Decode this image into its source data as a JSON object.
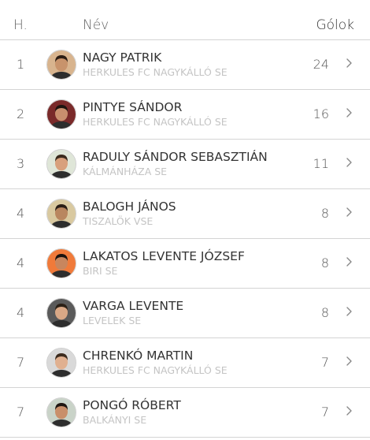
{
  "header": {
    "rank_label": "H.",
    "name_label": "Név",
    "goals_label": "Gólok"
  },
  "rows": [
    {
      "rank": "1",
      "name": "NAGY PATRIK",
      "club": "HERKULES FC NAGYKÁLLÓ SE",
      "goals": "24",
      "avatar_bg": "#d8b48e",
      "skin": "#c8936b",
      "hair": "#2b1d14"
    },
    {
      "rank": "2",
      "name": "PINTYE SÁNDOR",
      "club": "HERKULES FC NAGYKÁLLÓ SE",
      "goals": "16",
      "avatar_bg": "#7a2a2a",
      "skin": "#c98f6e",
      "hair": "#1e1410"
    },
    {
      "rank": "3",
      "name": "RADULY SÁNDOR SEBASZTIÁN",
      "club": "KÁLMÁNHÁZA SE",
      "goals": "11",
      "avatar_bg": "#dfe6d8",
      "skin": "#d8a07c",
      "hair": "#3a2a1c"
    },
    {
      "rank": "4",
      "name": "BALOGH JÁNOS",
      "club": "TISZALÖK VSE",
      "goals": "8",
      "avatar_bg": "#d9c9a0",
      "skin": "#b9865f",
      "hair": "#2a1e16"
    },
    {
      "rank": "4",
      "name": "LAKATOS LEVENTE JÓZSEF",
      "club": "BIRI SE",
      "goals": "8",
      "avatar_bg": "#f07a3a",
      "skin": "#c8865e",
      "hair": "#1a120e"
    },
    {
      "rank": "4",
      "name": "VARGA LEVENTE",
      "club": "LEVELEK SE",
      "goals": "8",
      "avatar_bg": "#5a5a5a",
      "skin": "#d9a886",
      "hair": "#2b2016"
    },
    {
      "rank": "7",
      "name": "CHRENKÓ MARTIN",
      "club": "HERKULES FC NAGYKÁLLÓ SE",
      "goals": "7",
      "avatar_bg": "#d9d9d9",
      "skin": "#e0b090",
      "hair": "#3b2a1d"
    },
    {
      "rank": "7",
      "name": "PONGÓ RÓBERT",
      "club": "BALKÁNYI SE",
      "goals": "7",
      "avatar_bg": "#c9d3c8",
      "skin": "#c98f6a",
      "hair": "#1f1611"
    }
  ],
  "icons": {
    "row_chevron": "chevron-right-icon",
    "avatar": "player-photo"
  },
  "colors": {
    "text": "#333333",
    "club_text": "#c4c4c4",
    "divider": "#d4d4d4"
  }
}
